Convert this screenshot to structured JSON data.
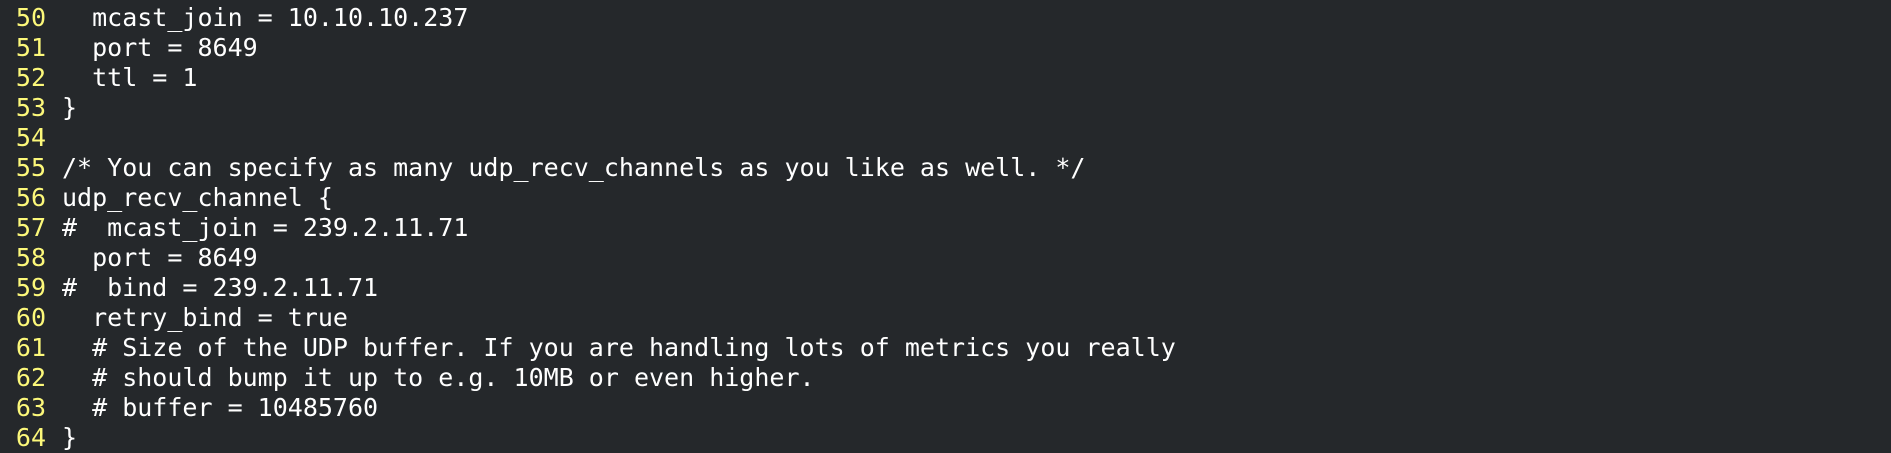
{
  "editor": {
    "lines": [
      {
        "number": "50",
        "text": "  mcast_join = 10.10.10.237"
      },
      {
        "number": "51",
        "text": "  port = 8649"
      },
      {
        "number": "52",
        "text": "  ttl = 1"
      },
      {
        "number": "53",
        "text": "}"
      },
      {
        "number": "54",
        "text": ""
      },
      {
        "number": "55",
        "text": "/* You can specify as many udp_recv_channels as you like as well. */"
      },
      {
        "number": "56",
        "text": "udp_recv_channel {"
      },
      {
        "number": "57",
        "text": "#  mcast_join = 239.2.11.71"
      },
      {
        "number": "58",
        "text": "  port = 8649"
      },
      {
        "number": "59",
        "text": "#  bind = 239.2.11.71"
      },
      {
        "number": "60",
        "text": "  retry_bind = true"
      },
      {
        "number": "61",
        "text": "  # Size of the UDP buffer. If you are handling lots of metrics you really"
      },
      {
        "number": "62",
        "text": "  # should bump it up to e.g. 10MB or even higher."
      },
      {
        "number": "63",
        "text": "  # buffer = 10485760"
      },
      {
        "number": "64",
        "text": "}"
      }
    ],
    "colors": {
      "background": "#25282b",
      "line_number": "#fcf87a",
      "text": "#ffffff"
    }
  }
}
